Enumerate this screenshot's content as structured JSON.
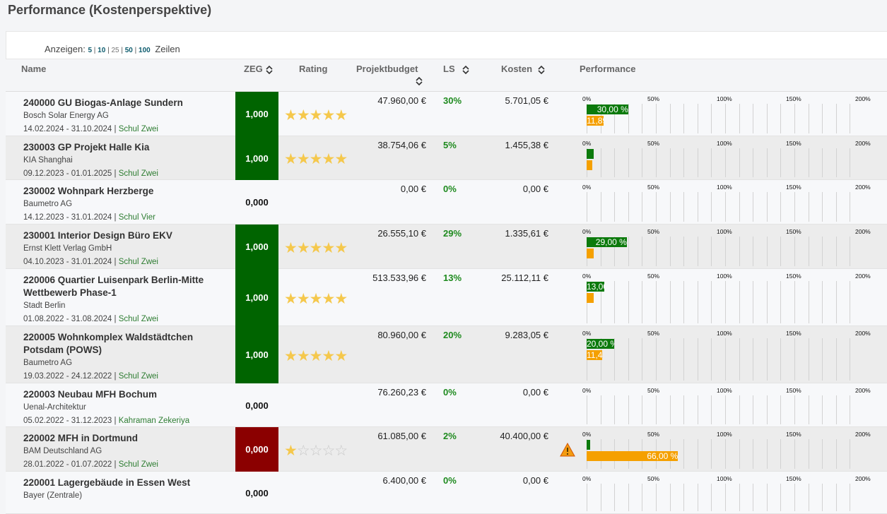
{
  "page_title": "Performance (Kostenperspektive)",
  "pager": {
    "label": "Anzeigen:",
    "options": [
      "5",
      "10",
      "25",
      "50",
      "100"
    ],
    "suffix": "Zeilen"
  },
  "columns": {
    "name": "Name",
    "zeg": "ZEG",
    "rating": "Rating",
    "budget": "Projektbudget",
    "ls": "LS",
    "kosten": "Kosten",
    "performance": "Performance"
  },
  "scale_ticks": [
    "0%",
    "50%",
    "100%",
    "150%",
    "200%"
  ],
  "colors": {
    "zeg_good": "#006400",
    "zeg_bad": "#8b0000",
    "bar_ls": "#0c7a0c",
    "bar_cost": "#f5a000",
    "star": "#f5c84c"
  },
  "projects": [
    {
      "name": "240000 GU Biogas-Anlage Sundern",
      "client": "Bosch Solar Energy AG",
      "dates": "14.02.2024 - 31.10.2024",
      "manager": "Schul Zwei",
      "zeg": "1,000",
      "zeg_status": "good",
      "rating": 5,
      "budget": "47.960,00 €",
      "ls": "30%",
      "kosten": "5.701,05 €",
      "bar_ls": {
        "value": 30,
        "label": "30,00 %"
      },
      "bar_cost": {
        "value": 12,
        "label": "11,89 %"
      },
      "warning": false
    },
    {
      "name": "230003 GP Projekt Halle Kia",
      "client": "KIA Shanghai",
      "dates": "09.12.2023 - 01.01.2025",
      "manager": "Schul Zwei",
      "zeg": "1,000",
      "zeg_status": "good",
      "rating": 5,
      "budget": "38.754,06 €",
      "ls": "5%",
      "kosten": "1.455,38 €",
      "bar_ls": {
        "value": 5,
        "label": ""
      },
      "bar_cost": {
        "value": 4,
        "label": ""
      },
      "warning": false
    },
    {
      "name": "230002 Wohnpark Herzberge",
      "client": "Baumetro AG",
      "dates": "14.12.2023 - 31.01.2024",
      "manager": "Schul Vier",
      "zeg": "0,000",
      "zeg_status": "none",
      "rating": 0,
      "budget": "0,00 €",
      "ls": "0%",
      "kosten": "0,00 €",
      "bar_ls": {
        "value": 0,
        "label": ""
      },
      "bar_cost": {
        "value": 0,
        "label": ""
      },
      "warning": false
    },
    {
      "name": "230001 Interior Design Büro EKV",
      "client": "Ernst Klett Verlag GmbH",
      "dates": "04.10.2023 - 31.01.2024",
      "manager": "Schul Zwei",
      "zeg": "1,000",
      "zeg_status": "good",
      "rating": 5,
      "budget": "26.555,10 €",
      "ls": "29%",
      "kosten": "1.335,61 €",
      "bar_ls": {
        "value": 29,
        "label": "29,00 %"
      },
      "bar_cost": {
        "value": 5,
        "label": ""
      },
      "warning": false
    },
    {
      "name": "220006 Quartier Luisenpark Berlin-Mitte Wettbewerb Phase-1",
      "client": "Stadt Berlin",
      "dates": "01.08.2022 - 31.08.2024",
      "manager": "Schul Zwei",
      "zeg": "1,000",
      "zeg_status": "good",
      "rating": 5,
      "budget": "513.533,96 €",
      "ls": "13%",
      "kosten": "25.112,11 €",
      "bar_ls": {
        "value": 13,
        "label": "13,00 %"
      },
      "bar_cost": {
        "value": 5,
        "label": ""
      },
      "warning": false
    },
    {
      "name": "220005 Wohnkomplex Waldstädtchen Potsdam (POWS)",
      "client": "Baumetro AG",
      "dates": "19.03.2022 - 24.12.2022",
      "manager": "Schul Zwei",
      "zeg": "1,000",
      "zeg_status": "good",
      "rating": 5,
      "budget": "80.960,00 €",
      "ls": "20%",
      "kosten": "9.283,05 €",
      "bar_ls": {
        "value": 20,
        "label": "20,00 %"
      },
      "bar_cost": {
        "value": 11,
        "label": "11,47 %"
      },
      "warning": false
    },
    {
      "name": "220003 Neubau MFH Bochum",
      "client": "Uenal-Architektur",
      "dates": "05.02.2022 - 31.12.2023",
      "manager": "Kahraman Zekeriya",
      "zeg": "0,000",
      "zeg_status": "none",
      "rating": 0,
      "budget": "76.260,23 €",
      "ls": "0%",
      "kosten": "0,00 €",
      "bar_ls": {
        "value": 0,
        "label": ""
      },
      "bar_cost": {
        "value": 0,
        "label": ""
      },
      "warning": false
    },
    {
      "name": "220002 MFH in Dortmund",
      "client": "BAM Deutschland AG",
      "dates": "28.01.2022 - 01.07.2022",
      "manager": "Schul Zwei",
      "zeg": "0,000",
      "zeg_status": "bad",
      "rating": 1,
      "budget": "61.085,00 €",
      "ls": "2%",
      "kosten": "40.400,00 €",
      "bar_ls": {
        "value": 2,
        "label": ""
      },
      "bar_cost": {
        "value": 66,
        "label": "66,00 %"
      },
      "warning": true
    },
    {
      "name": "220001 Lagergebäude in Essen West",
      "client": "Bayer (Zentrale)",
      "dates": "",
      "manager": "",
      "zeg": "0,000",
      "zeg_status": "none",
      "rating": 0,
      "budget": "6.400,00 €",
      "ls": "0%",
      "kosten": "0,00 €",
      "bar_ls": {
        "value": 0,
        "label": ""
      },
      "bar_cost": {
        "value": 0,
        "label": ""
      },
      "warning": false
    }
  ]
}
